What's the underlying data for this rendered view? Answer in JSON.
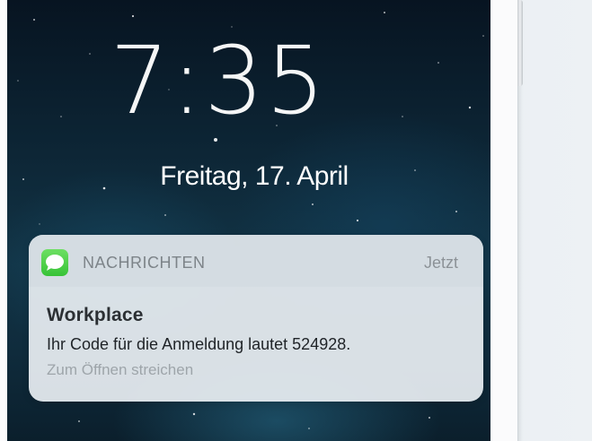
{
  "lock_screen": {
    "time": "7:35",
    "date": "Freitag, 17. April"
  },
  "notification": {
    "app_icon": "messages-icon",
    "app_name": "NACHRICHTEN",
    "time": "Jetzt",
    "title": "Workplace",
    "body": "Ihr Code für die Anmeldung lautet 524928.",
    "hint": "Zum Öffnen streichen"
  },
  "colors": {
    "messages_green": "#4cd964",
    "wallpaper_dark": "#0d2636"
  }
}
